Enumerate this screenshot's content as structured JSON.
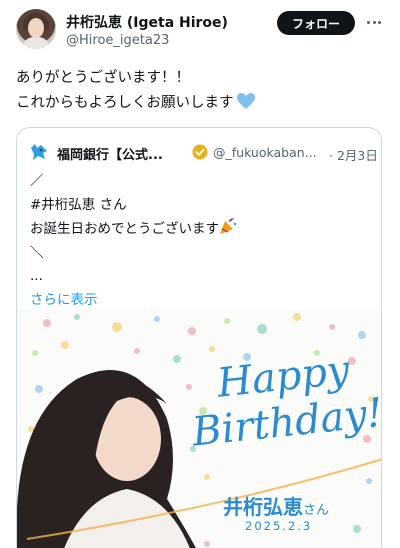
{
  "author": {
    "name": "井桁弘恵 (Igeta Hiroe)",
    "handle": "@Hiroe_igeta23"
  },
  "actions": {
    "follow_label": "フォロー",
    "more_icon": "more-horizontal-icon"
  },
  "tweet": {
    "lines": [
      "ありがとうございます！！",
      "これからもよろしくお願いします"
    ],
    "emoji": "light-blue-heart"
  },
  "quoted": {
    "name": "福岡銀行【公式...",
    "handle": "@_fukuokaban...",
    "date": "· 2月3日",
    "lines": [
      "／",
      "#井桁弘恵 さん",
      "お誕生日おめでとうございます",
      "＼",
      "..."
    ],
    "show_more": "さらに表示",
    "image": {
      "title_line1": "Happy",
      "title_line2": "Birthday!",
      "name": "井桁弘恵",
      "name_suffix": "さん",
      "date": "2025.2.3"
    }
  },
  "colors": {
    "link": "#1d9bf0",
    "text": "#0f1419",
    "muted": "#536471",
    "follow_bg": "#0f1419",
    "image_accent": "#2a8bd0"
  }
}
